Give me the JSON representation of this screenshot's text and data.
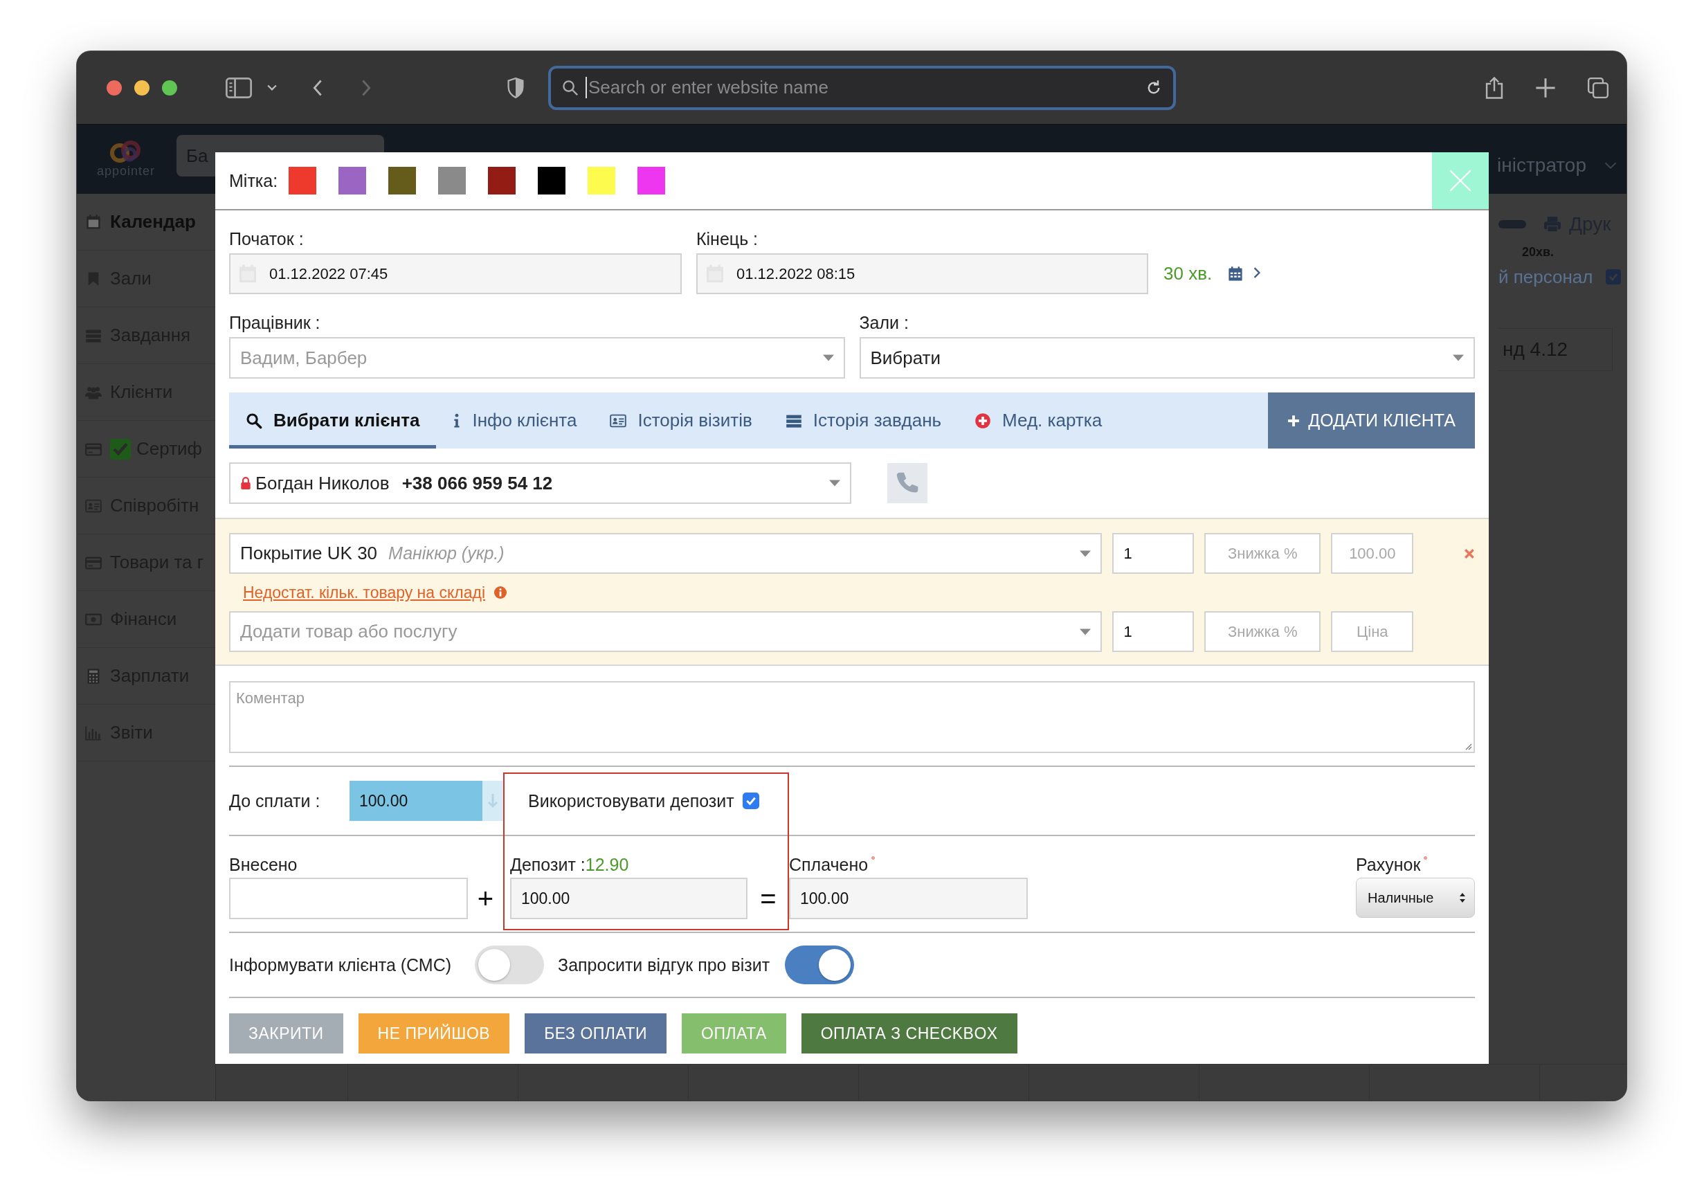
{
  "browser": {
    "address_placeholder": "Search or enter website name"
  },
  "app": {
    "logo": "appointer",
    "header_field": "Ба",
    "user_menu": "іністратор",
    "sidebar": [
      {
        "label": "Календар",
        "selected": true
      },
      {
        "label": "Зали",
        "selected": false
      },
      {
        "label": "Завдання",
        "selected": false
      },
      {
        "label": "Клієнти",
        "selected": false
      },
      {
        "label": "Сертиф",
        "selected": false
      },
      {
        "label": "Співробітн",
        "selected": false
      },
      {
        "label": "Товари та г",
        "selected": false
      },
      {
        "label": "Фінанси",
        "selected": false
      },
      {
        "label": "Зарплати",
        "selected": false
      },
      {
        "label": "Звіти",
        "selected": false
      }
    ],
    "print_button": "Друк",
    "interval": "20хв.",
    "staff_filter": {
      "label": "й персонал",
      "checked": true
    },
    "day_header": "нд 4.12"
  },
  "modal": {
    "tag_label": "Мітка:",
    "tags": [
      {
        "color": "#ee3a2c"
      },
      {
        "color": "#9b66c3"
      },
      {
        "color": "#655b1b"
      },
      {
        "color": "#8a8a8a"
      },
      {
        "color": "#931c14"
      },
      {
        "color": "#000000"
      },
      {
        "color": "#fdfb4e"
      },
      {
        "color": "#ee36f0"
      }
    ],
    "start": {
      "label": "Початок :",
      "value": "01.12.2022 07:45"
    },
    "end": {
      "label": "Кінець :",
      "value": "01.12.2022 08:15"
    },
    "duration": "30 хв.",
    "employee": {
      "label": "Працівник :",
      "placeholder": "Вадим, Барбер"
    },
    "halls": {
      "label": "Зали :",
      "value": "Вибрати"
    },
    "tabs": [
      {
        "label": "Вибрати клієнта",
        "selected": true
      },
      {
        "label": "Інфо клієнта",
        "selected": false
      },
      {
        "label": "Історія візитів",
        "selected": false
      },
      {
        "label": "Історія завдань",
        "selected": false
      },
      {
        "label": "Мед. картка",
        "selected": false
      }
    ],
    "add_client_button": "ДОДАТИ КЛІЄНТА",
    "client": {
      "name": "Богдан Николов",
      "phone": "+38 066 959 54 12"
    },
    "items": [
      {
        "kind": "line",
        "service": "Покрытие UK 30",
        "category": "Манікюр (укр.)",
        "quantity": "1",
        "discount_placeholder": "Знижка %",
        "price": "100.00",
        "warning": "Недостат. кільк. товару на складі"
      },
      {
        "kind": "new",
        "placeholder": "Додати товар або послугу",
        "quantity": "1",
        "discount_placeholder": "Знижка %",
        "price_placeholder": "Ціна"
      }
    ],
    "comment_placeholder": "Коментар",
    "to_pay": {
      "label": "До сплати :",
      "value": "100.00"
    },
    "use_deposit": {
      "label": "Використовувати депозит",
      "checked": true
    },
    "paid_in": {
      "label": "Внесено"
    },
    "plus_sign": "+",
    "deposit": {
      "label": "Депозит :",
      "balance": "12.90",
      "value": "100.00"
    },
    "equals_sign": "=",
    "paid": {
      "label": "Сплачено",
      "required": true,
      "value": "100.00"
    },
    "account": {
      "label": "Рахунок",
      "required": true,
      "value": "Наличные"
    },
    "sms": {
      "label": "Інформувати клієнта (СМС)",
      "on": false
    },
    "feedback": {
      "label": "Запросити відгук про візит",
      "on": true
    },
    "buttons": [
      {
        "label": "ЗАКРИТИ",
        "color": "#a5adb4"
      },
      {
        "label": "НЕ ПРИЙШОВ",
        "color": "#f2a63c"
      },
      {
        "label": "БЕЗ ОПЛАТИ",
        "color": "#5a739a"
      },
      {
        "label": "ОПЛАТА",
        "color": "#85be6d"
      },
      {
        "label": "ОПЛАТА З CHECKBOX",
        "color": "#4e7a41"
      }
    ]
  }
}
